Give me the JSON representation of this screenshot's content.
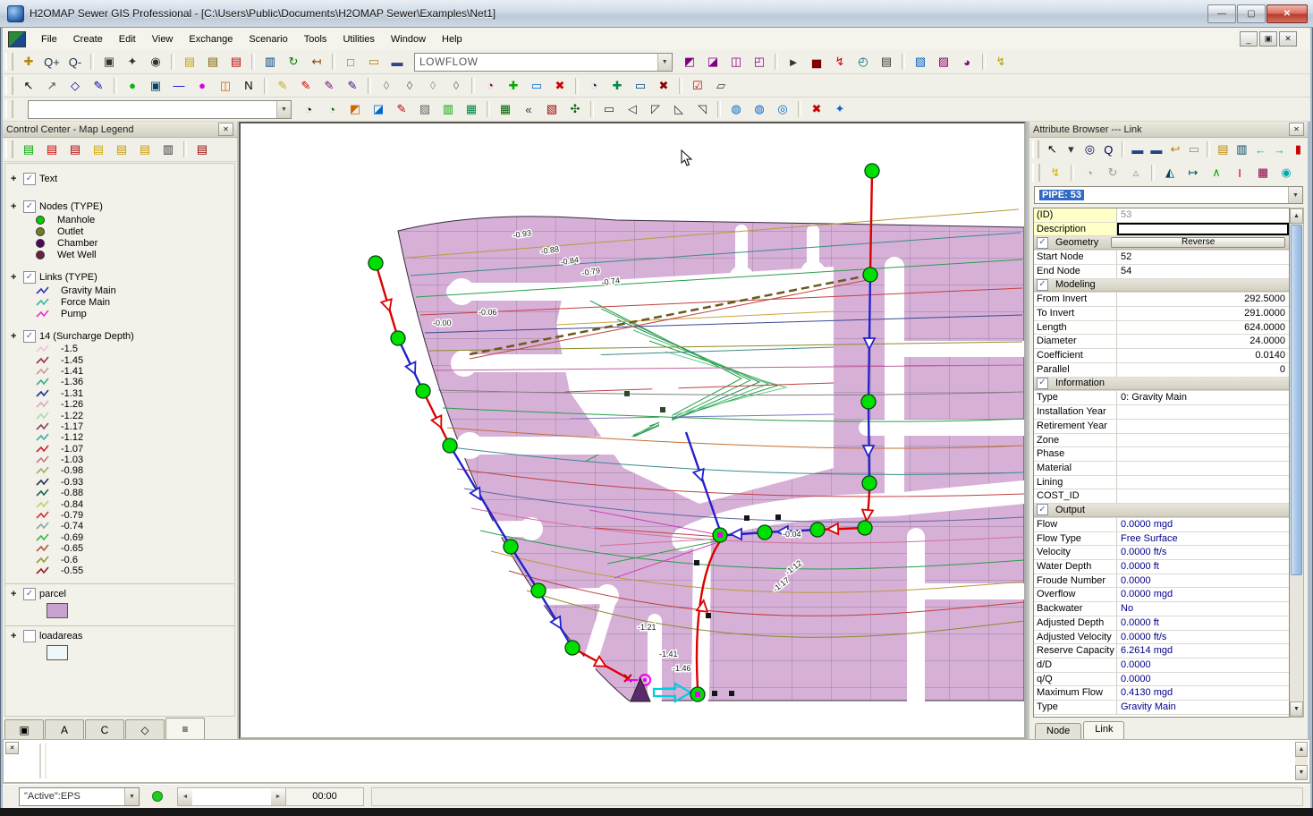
{
  "window": {
    "title": "H2OMAP Sewer GIS Professional - [C:\\Users\\Public\\Documents\\H2OMAP Sewer\\Examples\\Net1]",
    "minimize_glyph": "—",
    "maximize_glyph": "▢",
    "close_glyph": "✕"
  },
  "menu": {
    "items": [
      {
        "label": "File"
      },
      {
        "label": "Create"
      },
      {
        "label": "Edit"
      },
      {
        "label": "View"
      },
      {
        "label": "Exchange"
      },
      {
        "label": "Scenario"
      },
      {
        "label": "Tools"
      },
      {
        "label": "Utilities"
      },
      {
        "label": "Window"
      },
      {
        "label": "Help"
      }
    ]
  },
  "toolbars": {
    "scenario_value": "LOWFLOW",
    "row1a": [
      {
        "name": "pan-icon",
        "glyph": "✚",
        "color": "#b8860b"
      },
      {
        "name": "zoom-in-icon",
        "glyph": "Q+",
        "color": "#223355"
      },
      {
        "name": "zoom-out-icon",
        "glyph": "Q-",
        "color": "#223355"
      },
      {
        "sep": true
      },
      {
        "name": "zoom-window-icon",
        "glyph": "▣",
        "color": "#333333"
      },
      {
        "name": "zoom-extent-icon",
        "glyph": "✦",
        "color": "#333333"
      },
      {
        "name": "zoom-previous-icon",
        "glyph": "◉",
        "color": "#333333"
      },
      {
        "sep": true
      },
      {
        "name": "layer-add-icon",
        "glyph": "▤",
        "color": "#c8a000"
      },
      {
        "name": "layer-edit-icon",
        "glyph": "▤",
        "color": "#806000"
      },
      {
        "name": "layer-remove-icon",
        "glyph": "▤",
        "color": "#c00000"
      },
      {
        "sep": true
      },
      {
        "name": "locate-icon",
        "glyph": "▥",
        "color": "#004080"
      },
      {
        "name": "refresh-icon",
        "glyph": "↻",
        "color": "#008000"
      },
      {
        "name": "measure-icon",
        "glyph": "↤",
        "color": "#804000"
      },
      {
        "sep": true
      },
      {
        "name": "new-file-icon",
        "glyph": "□",
        "color": "#666666"
      },
      {
        "name": "open-file-icon",
        "glyph": "▭",
        "color": "#b8860b"
      },
      {
        "name": "save-file-icon",
        "glyph": "▬",
        "color": "#334488"
      }
    ],
    "row1b": [
      {
        "name": "query-node-icon",
        "glyph": "◩",
        "color": "#800080"
      },
      {
        "name": "query-link-icon",
        "glyph": "◪",
        "color": "#800080"
      },
      {
        "name": "db-browse-icon",
        "glyph": "◫",
        "color": "#800080"
      },
      {
        "name": "db-edit-icon",
        "glyph": "◰",
        "color": "#800080"
      },
      {
        "sep": true
      },
      {
        "name": "run-manager-icon",
        "glyph": "►",
        "color": "#333333"
      },
      {
        "name": "graph-icon",
        "glyph": "▅",
        "color": "#800000"
      },
      {
        "name": "flash-report-icon",
        "glyph": "↯",
        "color": "#cc0000"
      },
      {
        "name": "gauge-icon",
        "glyph": "◴",
        "color": "#006080"
      },
      {
        "name": "report-icon",
        "glyph": "▤",
        "color": "#333333"
      },
      {
        "sep": true
      },
      {
        "name": "map-display-icon",
        "glyph": "▧",
        "color": "#0060c0"
      },
      {
        "name": "output-report-icon",
        "glyph": "▨",
        "color": "#880066"
      },
      {
        "name": "query-user-icon",
        "glyph": "◕",
        "color": "#880066"
      },
      {
        "sep": true
      },
      {
        "name": "annotate-icon",
        "glyph": "↯",
        "color": "#b8a000"
      }
    ],
    "row2": [
      {
        "name": "select-icon",
        "glyph": "↖",
        "color": "#000000"
      },
      {
        "name": "vertex-select-icon",
        "glyph": "↗",
        "color": "#555555"
      },
      {
        "name": "polygon-select-icon",
        "glyph": "◇",
        "color": "#0000aa"
      },
      {
        "name": "path-select-icon",
        "glyph": "✎",
        "color": "#0000aa"
      },
      {
        "sep": true
      },
      {
        "name": "add-manhole-icon",
        "glyph": "●",
        "color": "#00bb00"
      },
      {
        "name": "add-wetwell-icon",
        "glyph": "▣",
        "color": "#004466"
      },
      {
        "name": "add-link-icon",
        "glyph": "—",
        "color": "#0000cc"
      },
      {
        "name": "add-pump-icon",
        "glyph": "●",
        "color": "#dd00dd"
      },
      {
        "name": "add-junction-icon",
        "glyph": "◫",
        "color": "#cc6600"
      },
      {
        "name": "add-text-icon",
        "glyph": "N",
        "color": "#000000"
      },
      {
        "sep": true
      },
      {
        "name": "edit-yellow-icon",
        "glyph": "✎",
        "color": "#ccaa00"
      },
      {
        "name": "edit-red-icon",
        "glyph": "✎",
        "color": "#cc0000"
      },
      {
        "name": "brush-icon",
        "glyph": "✎",
        "color": "#880088"
      },
      {
        "name": "brush-box-icon",
        "glyph": "✎",
        "color": "#440088"
      },
      {
        "sep": true
      },
      {
        "name": "erase-icon",
        "glyph": "◊",
        "color": "#888888"
      },
      {
        "name": "erase-arc-icon",
        "glyph": "◊",
        "color": "#666666"
      },
      {
        "name": "erase-open-icon",
        "glyph": "◊",
        "color": "#999999"
      },
      {
        "name": "erase-fill-icon",
        "glyph": "◊",
        "color": "#777777"
      },
      {
        "sep": true
      },
      {
        "name": "select-node-icon",
        "glyph": "◔",
        "color": "#880066"
      },
      {
        "name": "add-selection-icon",
        "glyph": "✚",
        "color": "#00aa00"
      },
      {
        "name": "move-selection-icon",
        "glyph": "▭",
        "color": "#0066cc"
      },
      {
        "name": "delete-selection-icon",
        "glyph": "✖",
        "color": "#cc0000"
      },
      {
        "sep": true
      },
      {
        "name": "select-link-icon",
        "glyph": "◔",
        "color": "#440066"
      },
      {
        "name": "add-vertex-icon",
        "glyph": "✚",
        "color": "#008844"
      },
      {
        "name": "move-vertex-icon",
        "glyph": "▭",
        "color": "#004488"
      },
      {
        "name": "delete-vertex-icon",
        "glyph": "✖",
        "color": "#880000"
      },
      {
        "sep": true
      },
      {
        "name": "validate-icon",
        "glyph": "☑",
        "color": "#cc0000"
      },
      {
        "name": "trace-icon",
        "glyph": "▱",
        "color": "#333333"
      }
    ],
    "row3": [
      {
        "name": "domain-node-icon",
        "glyph": "◔",
        "color": "#000000"
      },
      {
        "name": "domain-add-icon",
        "glyph": "◔",
        "color": "#006600"
      },
      {
        "name": "domain-flag-icon",
        "glyph": "◩",
        "color": "#cc6600"
      },
      {
        "name": "domain-box-icon",
        "glyph": "◪",
        "color": "#0066cc"
      },
      {
        "name": "domain-edit-icon",
        "glyph": "✎",
        "color": "#cc0000"
      },
      {
        "name": "domain-map-icon",
        "glyph": "▨",
        "color": "#666666"
      },
      {
        "name": "domain-grid-icon",
        "glyph": "▥",
        "color": "#00aa00"
      },
      {
        "name": "domain-net-icon",
        "glyph": "▦",
        "color": "#008844"
      },
      {
        "sep": true
      },
      {
        "name": "subnet-icon",
        "glyph": "▦",
        "color": "#006600"
      },
      {
        "name": "subnet-back-icon",
        "glyph": "«",
        "color": "#333333"
      },
      {
        "name": "subnet-add-icon",
        "glyph": "▧",
        "color": "#990000"
      },
      {
        "name": "subnet-tree-icon",
        "glyph": "✣",
        "color": "#006600"
      },
      {
        "sep": true
      },
      {
        "name": "shape-rect-icon",
        "glyph": "▭",
        "color": "#333333"
      },
      {
        "name": "shape-poly-icon",
        "glyph": "◁",
        "color": "#333333"
      },
      {
        "name": "shape-edit-icon",
        "glyph": "◸",
        "color": "#333333"
      },
      {
        "name": "shape-move-icon",
        "glyph": "◺",
        "color": "#333333"
      },
      {
        "name": "shape-rotate-icon",
        "glyph": "◹",
        "color": "#333333"
      },
      {
        "sep": true
      },
      {
        "name": "parallel-1-icon",
        "glyph": "◍",
        "color": "#0066cc"
      },
      {
        "name": "parallel-2-icon",
        "glyph": "◍",
        "color": "#0066cc"
      },
      {
        "name": "parallel-3-icon",
        "glyph": "◎",
        "color": "#0066cc"
      },
      {
        "sep": true
      },
      {
        "name": "clear-icon",
        "glyph": "✖",
        "color": "#cc0000"
      },
      {
        "name": "anchor-icon",
        "glyph": "✦",
        "color": "#0066cc"
      }
    ]
  },
  "control_center": {
    "title": "Control Center - Map Legend",
    "toolbar": [
      {
        "name": "layer-new-icon",
        "glyph": "▤",
        "color": "#00aa00"
      },
      {
        "name": "layer-delete-icon",
        "glyph": "▤",
        "color": "#cc0000"
      },
      {
        "name": "layer-clear-icon",
        "glyph": "▤",
        "color": "#aa0000"
      },
      {
        "name": "layer-edit-icon",
        "glyph": "▤",
        "color": "#ccaa00"
      },
      {
        "name": "layer-plus-icon",
        "glyph": "▤",
        "color": "#cc9900"
      },
      {
        "name": "layer-minus-icon",
        "glyph": "▤",
        "color": "#cc9900"
      },
      {
        "name": "layer-ruler-icon",
        "glyph": "▥",
        "color": "#333333"
      },
      {
        "sep": true
      },
      {
        "name": "layer-red-icon",
        "glyph": "▤",
        "color": "#990000"
      }
    ],
    "tree": {
      "text_label": "Text",
      "nodes_label": "Nodes (TYPE)",
      "node_types": [
        {
          "label": "Manhole",
          "color": "#00cc00"
        },
        {
          "label": "Outlet",
          "color": "#7a7a20"
        },
        {
          "label": "Chamber",
          "color": "#4a0a5a"
        },
        {
          "label": "Wet Well",
          "color": "#6a2040"
        }
      ],
      "links_label": "Links (TYPE)",
      "link_types": [
        {
          "label": "Gravity Main",
          "color": "#3333bb"
        },
        {
          "label": "Force Main",
          "color": "#33bb99"
        },
        {
          "label": "Pump",
          "color": "#ee33cc"
        }
      ],
      "surcharge_label": "14 (Surcharge Depth)",
      "surcharge_values": [
        {
          "label": "-1.5",
          "color": "#ecc8d8"
        },
        {
          "label": "-1.45",
          "color": "#993344"
        },
        {
          "label": "-1.41",
          "color": "#cc9999"
        },
        {
          "label": "-1.36",
          "color": "#44aa88"
        },
        {
          "label": "-1.31",
          "color": "#223388"
        },
        {
          "label": "-1.26",
          "color": "#ddaabb"
        },
        {
          "label": "-1.22",
          "color": "#aaddaa"
        },
        {
          "label": "-1.17",
          "color": "#884455"
        },
        {
          "label": "-1.12",
          "color": "#44aaaa"
        },
        {
          "label": "-1.07",
          "color": "#cc2233"
        },
        {
          "label": "-1.03",
          "color": "#cc7788"
        },
        {
          "label": "-0.98",
          "color": "#aaa866"
        },
        {
          "label": "-0.93",
          "color": "#223355"
        },
        {
          "label": "-0.88",
          "color": "#226655"
        },
        {
          "label": "-0.84",
          "color": "#cccc66"
        },
        {
          "label": "-0.79",
          "color": "#cc3333"
        },
        {
          "label": "-0.74",
          "color": "#88aaa8"
        },
        {
          "label": "-0.69",
          "color": "#33bb44"
        },
        {
          "label": "-0.65",
          "color": "#bb5544"
        },
        {
          "label": "-0.6",
          "color": "#999933"
        },
        {
          "label": "-0.55",
          "color": "#992222"
        }
      ],
      "parcel_label": "parcel",
      "parcel_color": "#c9a3cf",
      "loadareas_label": "loadareas",
      "loadareas_color": "#eef8f8"
    },
    "tabs": [
      {
        "name": "tab-map-icon",
        "glyph": "▣"
      },
      {
        "name": "tab-annotation-icon",
        "glyph": "A"
      },
      {
        "name": "tab-contour-icon",
        "glyph": "C"
      },
      {
        "name": "tab-domain-icon",
        "glyph": "◇"
      },
      {
        "name": "tab-legend-icon",
        "glyph": "≡",
        "active": true
      }
    ]
  },
  "map": {
    "labels": [
      "-0.93",
      "-0.88",
      "-0.84",
      "-0.79",
      "-0.74",
      "-0.06",
      "-0.00",
      "-0.04",
      "-1.12",
      "-1.17",
      "-1.21",
      "-1.41",
      "-1.46"
    ],
    "parcel_color": "#d7b0d8",
    "manhole_color": "#00e000",
    "gravity_main_color": "#2222cc",
    "surcharge_red": "#dd0000"
  },
  "attribute_browser": {
    "title": "Attribute Browser --- Link",
    "toolbar1": [
      {
        "name": "ab-select-icon",
        "glyph": "↖",
        "color": "#000000"
      },
      {
        "name": "ab-select-dropdown-icon",
        "glyph": "▾",
        "color": "#333333"
      },
      {
        "name": "ab-find-icon",
        "glyph": "◎",
        "color": "#000044"
      },
      {
        "name": "ab-zoom-icon",
        "glyph": "Q",
        "color": "#000044"
      },
      {
        "sep": true
      },
      {
        "name": "ab-save-icon",
        "glyph": "▬",
        "color": "#224488"
      },
      {
        "name": "ab-save-all-icon",
        "glyph": "▬",
        "color": "#224488"
      },
      {
        "name": "ab-undo-icon",
        "glyph": "↩",
        "color": "#bb8800"
      },
      {
        "name": "ab-erase-icon",
        "glyph": "▭",
        "color": "#888888"
      },
      {
        "sep": true
      },
      {
        "name": "ab-notes-icon",
        "glyph": "▤",
        "color": "#bb8800"
      },
      {
        "name": "ab-graph-icon",
        "glyph": "▥",
        "color": "#004466"
      },
      {
        "name": "ab-prev-icon",
        "glyph": "←",
        "color": "#00bbcc"
      },
      {
        "name": "ab-next-icon",
        "glyph": "→",
        "color": "#00bbcc"
      },
      {
        "name": "ab-tools-icon",
        "glyph": "▮",
        "color": "#cc0000"
      }
    ],
    "toolbar2": [
      {
        "name": "ab-highlight-icon",
        "glyph": "↯",
        "color": "#ccbb00"
      },
      {
        "sep": true
      },
      {
        "name": "ab-faucet-icon",
        "glyph": "◔",
        "color": "#999999"
      },
      {
        "name": "ab-rotate-icon",
        "glyph": "↻",
        "color": "#999999"
      },
      {
        "name": "ab-profile-icon",
        "glyph": "▵",
        "color": "#999999"
      },
      {
        "sep": true
      },
      {
        "name": "ab-flag-icon",
        "glyph": "◭",
        "color": "#004466"
      },
      {
        "name": "ab-measure-icon",
        "glyph": "↦",
        "color": "#004466"
      },
      {
        "name": "ab-branch-icon",
        "glyph": "∧",
        "color": "#00aa00"
      },
      {
        "name": "ab-invert-icon",
        "glyph": "I",
        "color": "#cc0000"
      },
      {
        "name": "ab-video-icon",
        "glyph": "▦",
        "color": "#880044"
      },
      {
        "name": "ab-molecule-icon",
        "glyph": "◉",
        "color": "#00aaaa"
      }
    ],
    "selector": "PIPE: 53",
    "rows": [
      {
        "label": "(ID)",
        "value": "53",
        "label_yellow": true,
        "gray": true
      },
      {
        "label": "Description",
        "value": "",
        "label_yellow": true,
        "input": true
      },
      {
        "section": "Geometry",
        "button": "Reverse"
      },
      {
        "label": "Start Node",
        "value": "52"
      },
      {
        "label": "End Node",
        "value": "54"
      },
      {
        "section": "Modeling"
      },
      {
        "label": "From Invert",
        "value": "292.5000",
        "right": true
      },
      {
        "label": "To Invert",
        "value": "291.0000",
        "right": true
      },
      {
        "label": "Length",
        "value": "624.0000",
        "right": true
      },
      {
        "label": "Diameter",
        "value": "24.0000",
        "right": true
      },
      {
        "label": "Coefficient",
        "value": "0.0140",
        "right": true
      },
      {
        "label": "Parallel",
        "value": "0",
        "right": true
      },
      {
        "section": "Information"
      },
      {
        "label": "Type",
        "value": "0: Gravity Main"
      },
      {
        "label": "Installation Year",
        "value": ""
      },
      {
        "label": "Retirement Year",
        "value": ""
      },
      {
        "label": "Zone",
        "value": ""
      },
      {
        "label": "Phase",
        "value": ""
      },
      {
        "label": "Material",
        "value": ""
      },
      {
        "label": "Lining",
        "value": ""
      },
      {
        "label": "COST_ID",
        "value": ""
      },
      {
        "section": "Output"
      },
      {
        "label": "Flow",
        "value": "0.0000 mgd",
        "navy": true
      },
      {
        "label": "Flow Type",
        "value": "Free Surface",
        "navy": true
      },
      {
        "label": "Velocity",
        "value": "0.0000 ft/s",
        "navy": true
      },
      {
        "label": "Water Depth",
        "value": "0.0000 ft",
        "navy": true
      },
      {
        "label": "Froude Number",
        "value": "0.0000",
        "navy": true
      },
      {
        "label": "Overflow",
        "value": "0.0000 mgd",
        "navy": true
      },
      {
        "label": "Backwater",
        "value": "No",
        "navy": true
      },
      {
        "label": "Adjusted Depth",
        "value": "0.0000 ft",
        "navy": true
      },
      {
        "label": "Adjusted Velocity",
        "value": "0.0000 ft/s",
        "navy": true
      },
      {
        "label": "Reserve Capacity",
        "value": "6.2614 mgd",
        "navy": true
      },
      {
        "label": "d/D",
        "value": "0.0000",
        "navy": true
      },
      {
        "label": "q/Q",
        "value": "0.0000",
        "navy": true
      },
      {
        "label": "Maximum Flow",
        "value": "0.4130 mgd",
        "navy": true
      },
      {
        "label": "Type",
        "value": "Gravity Main",
        "navy": true
      }
    ],
    "tabs": [
      {
        "label": "Node"
      },
      {
        "label": "Link",
        "active": true
      }
    ]
  },
  "status_bar": {
    "scenario": "\"Active\":EPS",
    "time": "00:00"
  }
}
